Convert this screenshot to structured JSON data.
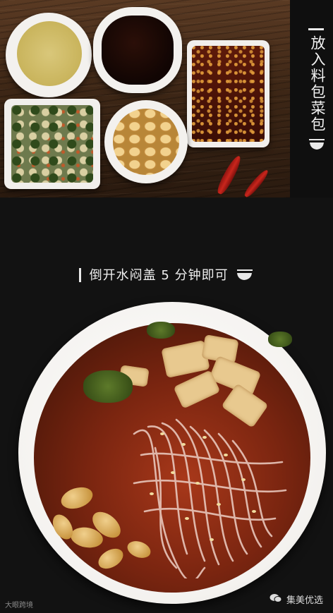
{
  "side_title": "放入料包菜包",
  "caption": "倒开水闷盖 5 分钟即可",
  "watermark_left": "大眼跨境",
  "watermark_right": "集美优选",
  "icons": {
    "side": "bowl-icon",
    "caption": "bowl-icon",
    "watermark": "wechat-icon"
  },
  "colors": {
    "background": "#121212",
    "text": "#f0f0f0"
  }
}
